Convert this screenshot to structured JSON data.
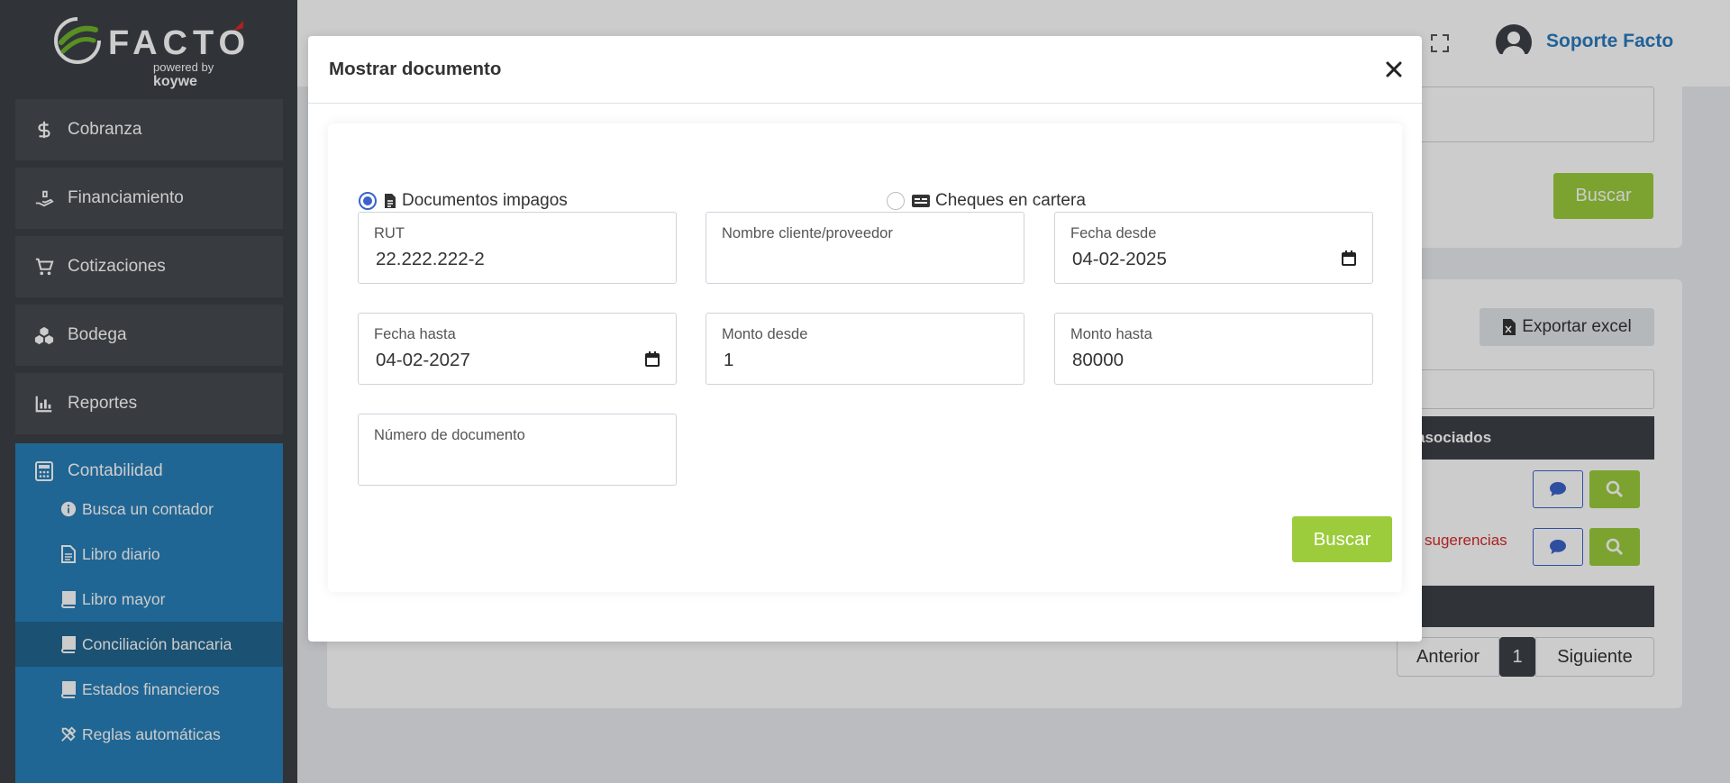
{
  "brand": {
    "name": "FACTO",
    "powered_by": "powered by",
    "partner": "koywe",
    "accent": "#9ccc3c",
    "logo_red": "#d82a2a"
  },
  "sidebar": {
    "items": [
      {
        "label": "Cobranza",
        "icon": "dollar-icon"
      },
      {
        "label": "Financiamiento",
        "icon": "hand-money-icon"
      },
      {
        "label": "Cotizaciones",
        "icon": "cart-icon"
      },
      {
        "label": "Bodega",
        "icon": "boxes-icon"
      },
      {
        "label": "Reportes",
        "icon": "bar-chart-icon"
      }
    ],
    "accounting": {
      "label": "Contabilidad",
      "icon": "calculator-icon",
      "subitems": [
        {
          "label": "Busca un contador",
          "icon": "info-icon"
        },
        {
          "label": "Libro diario",
          "icon": "file-text-icon"
        },
        {
          "label": "Libro mayor",
          "icon": "book-icon"
        },
        {
          "label": "Conciliación bancaria",
          "icon": "book-icon",
          "active": true
        },
        {
          "label": "Estados financieros",
          "icon": "book-icon"
        },
        {
          "label": "Reglas automáticas",
          "icon": "tools-icon"
        }
      ]
    }
  },
  "header": {
    "user_name": "Soporte Facto"
  },
  "background": {
    "search_label": "Buscar",
    "export_label": "Exportar excel",
    "table_header_fragment": "asociados",
    "suggestions_text": "sugerencias",
    "pager": {
      "prev": "Anterior",
      "page": "1",
      "next": "Siguiente"
    }
  },
  "modal": {
    "title": "Mostrar documento",
    "radios": [
      {
        "label": "Documentos impagos",
        "checked": true
      },
      {
        "label": "Cheques en cartera",
        "checked": false
      }
    ],
    "fields": {
      "rut": {
        "label": "RUT",
        "value": "22.222.222-2"
      },
      "nombre": {
        "label": "Nombre cliente/proveedor",
        "value": ""
      },
      "fecha_desde": {
        "label": "Fecha desde",
        "value": "04-02-2025"
      },
      "fecha_hasta": {
        "label": "Fecha hasta",
        "value": "04-02-2027"
      },
      "monto_desde": {
        "label": "Monto desde",
        "value": "1"
      },
      "monto_hasta": {
        "label": "Monto hasta",
        "value": "80000"
      },
      "numero_documento": {
        "label": "Número de documento",
        "value": ""
      }
    },
    "search_label": "Buscar"
  }
}
